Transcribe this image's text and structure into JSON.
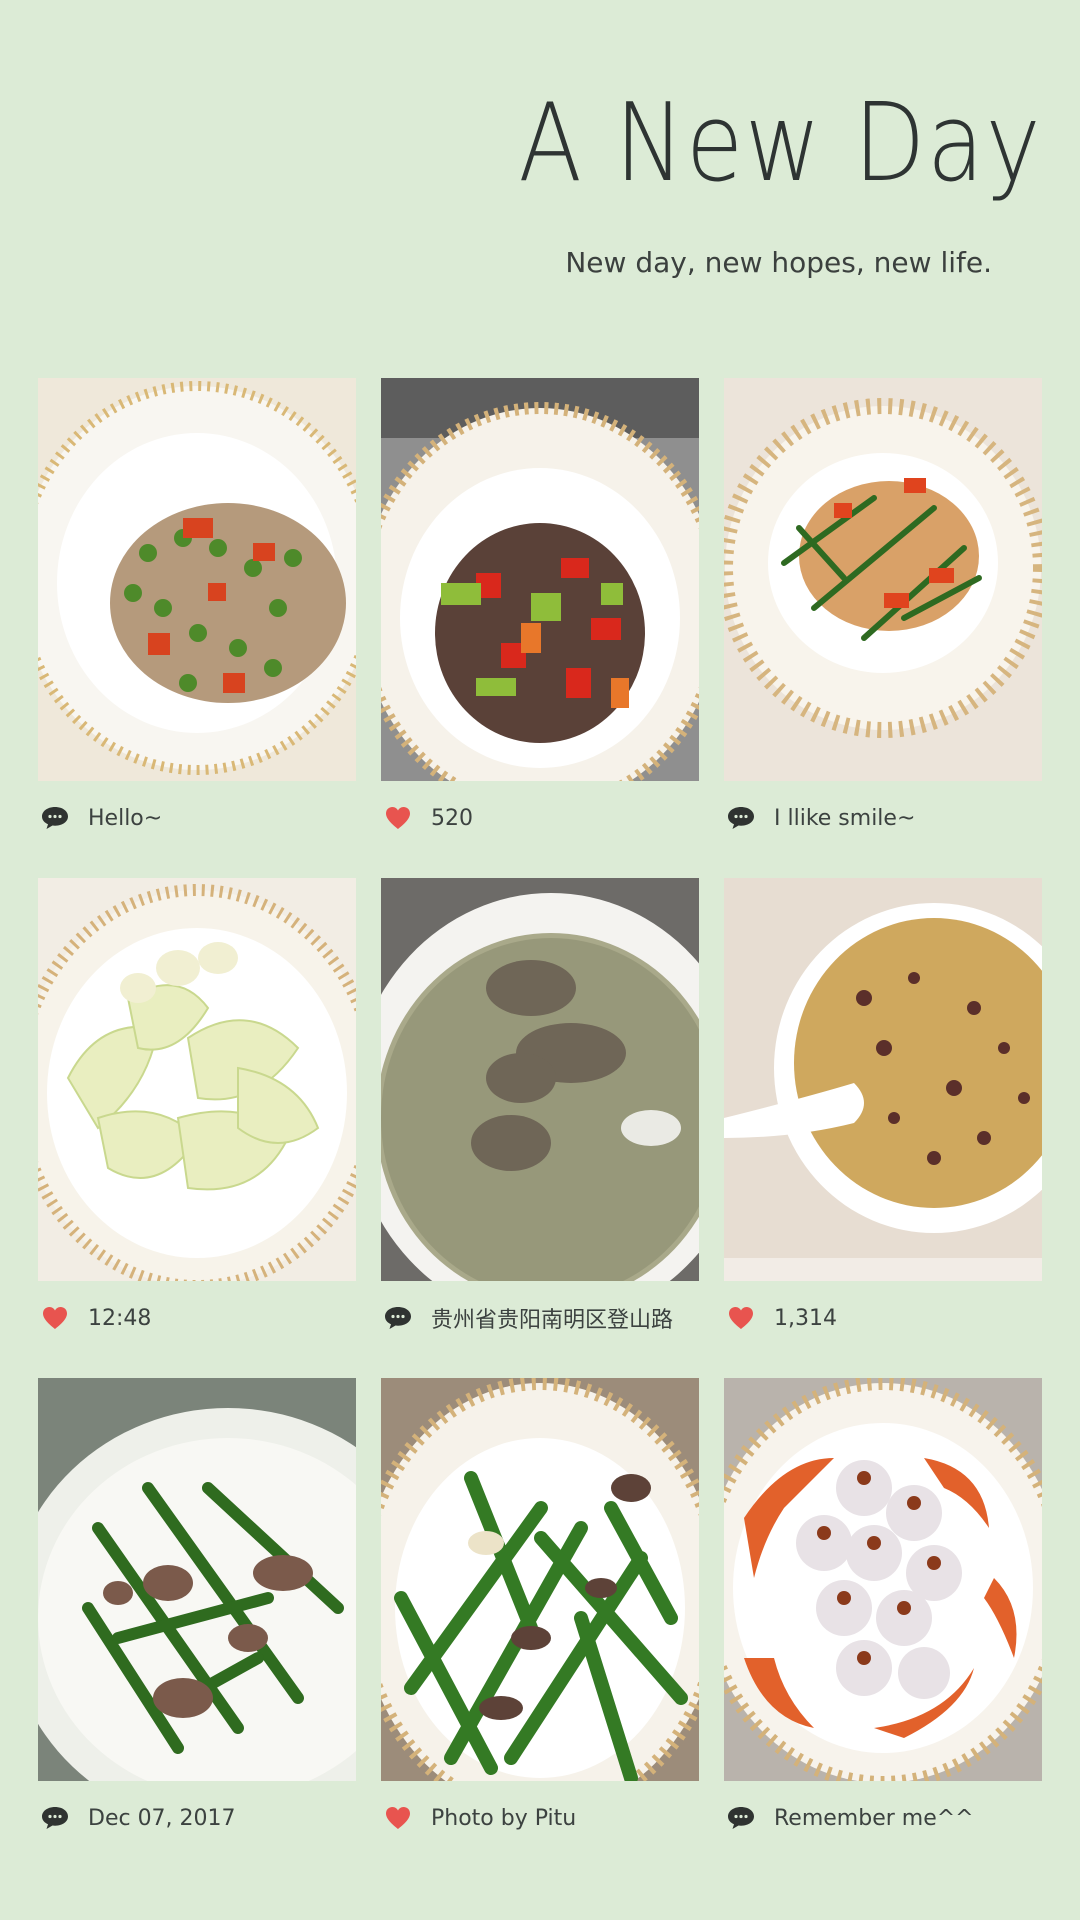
{
  "header": {
    "title": "A New Day",
    "subtitle": "New day, new hopes, new life."
  },
  "colors": {
    "background": "#dcebd6",
    "heart": "#e8544f",
    "comment": "#2f3331"
  },
  "cards": [
    {
      "icon": "comment-icon",
      "label": "Hello~",
      "photo": "peas-minced-pork-dish"
    },
    {
      "icon": "heart-icon",
      "label": "520",
      "photo": "beef-peppers-dish"
    },
    {
      "icon": "comment-icon",
      "label": "I llike smile~",
      "photo": "shrimp-garlic-sprouts-dish"
    },
    {
      "icon": "heart-icon",
      "label": "12:48",
      "photo": "napa-cabbage-dish"
    },
    {
      "icon": "comment-icon",
      "label": "贵州省贵阳南明区登山路",
      "photo": "clear-soup-bowl"
    },
    {
      "icon": "heart-icon",
      "label": "1,314",
      "photo": "porridge-bowl"
    },
    {
      "icon": "comment-icon",
      "label": "Dec 07, 2017",
      "photo": "beans-beef-dish"
    },
    {
      "icon": "heart-icon",
      "label": "Photo by Pitu",
      "photo": "green-beans-meat-dish"
    },
    {
      "icon": "comment-icon",
      "label": "Remember me^^",
      "photo": "pearl-meatballs-dish"
    }
  ]
}
